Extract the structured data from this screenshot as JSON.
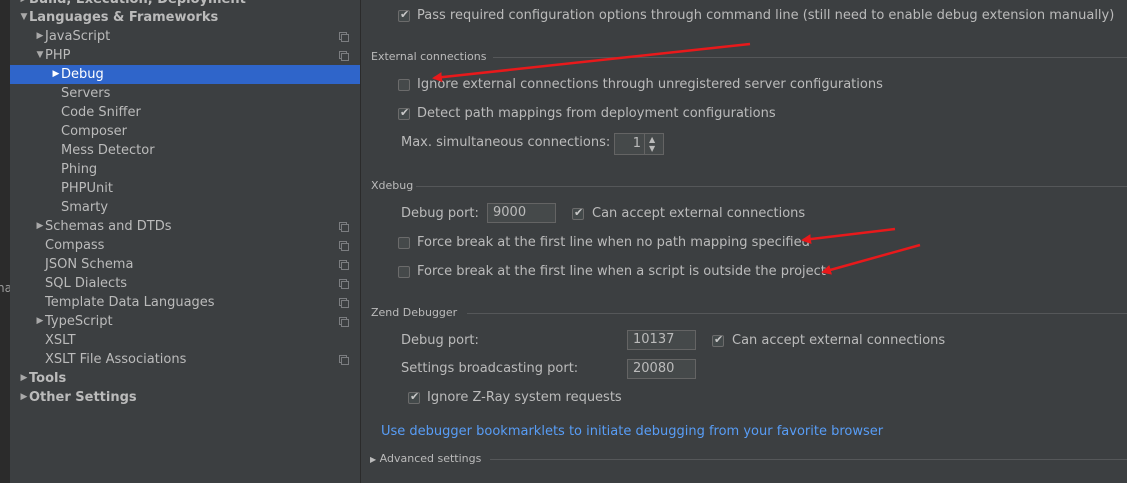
{
  "left_edge_text": "na",
  "sidebar": {
    "items": [
      {
        "label": "Build, Execution, Deployment",
        "arrow": "▶",
        "bold": true
      },
      {
        "label": "Languages & Frameworks",
        "arrow": "▼",
        "bold": true
      },
      {
        "label": "JavaScript",
        "arrow": "▶",
        "copy": true
      },
      {
        "label": "PHP",
        "arrow": "▼",
        "copy": true
      },
      {
        "label": "Debug",
        "arrow": "▶",
        "selected": true
      },
      {
        "label": "Servers"
      },
      {
        "label": "Code Sniffer"
      },
      {
        "label": "Composer"
      },
      {
        "label": "Mess Detector"
      },
      {
        "label": "Phing"
      },
      {
        "label": "PHPUnit"
      },
      {
        "label": "Smarty"
      },
      {
        "label": "Schemas and DTDs",
        "arrow": "▶",
        "copy": true
      },
      {
        "label": "Compass",
        "copy": true
      },
      {
        "label": "JSON Schema",
        "copy": true
      },
      {
        "label": "SQL Dialects",
        "copy": true
      },
      {
        "label": "Template Data Languages",
        "copy": true
      },
      {
        "label": "TypeScript",
        "arrow": "▶",
        "copy": true
      },
      {
        "label": "XSLT"
      },
      {
        "label": "XSLT File Associations",
        "copy": true
      },
      {
        "label": "Tools",
        "arrow": "▶",
        "bold": true
      },
      {
        "label": "Other Settings",
        "arrow": "▶",
        "bold": true
      }
    ]
  },
  "main": {
    "pass_options": {
      "label": "Pass required configuration options through command line (still need to enable debug extension manually)",
      "checked": true
    },
    "external_connections": {
      "title": "External connections",
      "ignore_unregistered": {
        "label": "Ignore external connections through unregistered server configurations",
        "checked": false
      },
      "detect_mappings": {
        "label": "Detect path mappings from deployment configurations",
        "checked": true
      },
      "max_connections_label": "Max. simultaneous connections:",
      "max_connections_value": "1"
    },
    "xdebug": {
      "title": "Xdebug",
      "debug_port_label": "Debug port:",
      "debug_port_value": "9000",
      "accept_external": {
        "label": "Can accept external connections",
        "checked": true
      },
      "force_break_no_mapping": {
        "label": "Force break at the first line when no path mapping specified",
        "checked": false
      },
      "force_break_outside": {
        "label": "Force break at the first line when a script is outside the project",
        "checked": false
      }
    },
    "zend": {
      "title": "Zend Debugger",
      "debug_port_label": "Debug port:",
      "debug_port_value": "10137",
      "accept_external": {
        "label": "Can accept external connections",
        "checked": true
      },
      "broadcast_label": "Settings broadcasting port:",
      "broadcast_value": "20080",
      "ignore_zray": {
        "label": "Ignore Z-Ray system requests",
        "checked": true
      }
    },
    "bookmarklets_link": "Use debugger bookmarklets to initiate debugging from your favorite browser",
    "advanced_settings": "Advanced settings"
  },
  "colors": {
    "background": "#3c3f41",
    "selection": "#2f65ca",
    "link": "#589df6",
    "annotation_arrow": "#e8191b"
  }
}
